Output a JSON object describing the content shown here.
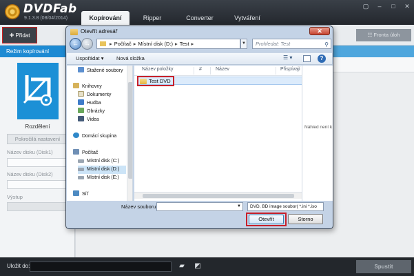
{
  "app": {
    "name": "DVDFab",
    "version": "9.1.3.8 (08/04/2014)",
    "tabs": [
      "Kopírování",
      "Ripper",
      "Converter",
      "Vytváření"
    ],
    "active_tab": "Kopírování"
  },
  "toolbar": {
    "add_label": "Přidat",
    "queue_label": "Fronta úloh"
  },
  "mode_bar": {
    "label": "Režim kopírování"
  },
  "sidebar": {
    "split_label": "Rozdělení",
    "advanced_settings": "Pokročilá nastavení",
    "disc1_label": "Název disku (Disk1)",
    "disc2_label": "Název disku (Disk2)",
    "output_label": "Výstup"
  },
  "bottom": {
    "save_to_label": "Uložit do:",
    "start_label": "Spustit"
  },
  "dialog": {
    "title": "Otevřít adresář",
    "address": {
      "segments": [
        "Počítač",
        "Místní disk (D:)",
        "Test"
      ]
    },
    "search_placeholder": "Prohledat: Test",
    "commands": {
      "organize": "Uspořádat",
      "new_folder": "Nová složka"
    },
    "tree": [
      {
        "label": "Stažené soubory",
        "icon": "download-folder-icon"
      },
      {
        "label": "Knihovny",
        "icon": "library-icon"
      },
      {
        "label": "Dokumenty",
        "icon": "documents-icon"
      },
      {
        "label": "Hudba",
        "icon": "music-icon"
      },
      {
        "label": "Obrázky",
        "icon": "pictures-icon"
      },
      {
        "label": "Videa",
        "icon": "videos-icon"
      },
      {
        "label": "Domácí skupina",
        "icon": "homegroup-icon"
      },
      {
        "label": "Počítač",
        "icon": "computer-icon"
      },
      {
        "label": "Místní disk (C:)",
        "icon": "drive-icon"
      },
      {
        "label": "Místní disk (D:)",
        "icon": "drive-icon"
      },
      {
        "label": "Místní disk (E:)",
        "icon": "drive-icon"
      },
      {
        "label": "Síť",
        "icon": "network-icon"
      }
    ],
    "columns": [
      "Název položky",
      "#",
      "Název",
      "Přispívají"
    ],
    "files": [
      {
        "name": "Test DVD",
        "type": "folder"
      }
    ],
    "preview_text": "Náhled není k dispozici.",
    "filename_label": "Název souboru:",
    "filename_value": "",
    "filetype_value": "DVD, BD image soubor( *.ini *.iso",
    "open_label": "Otevřít",
    "cancel_label": "Storno"
  },
  "colors": {
    "accent_blue": "#1c90d6",
    "highlight_red": "#c8202a",
    "title_bar_dark": "#23272d"
  }
}
